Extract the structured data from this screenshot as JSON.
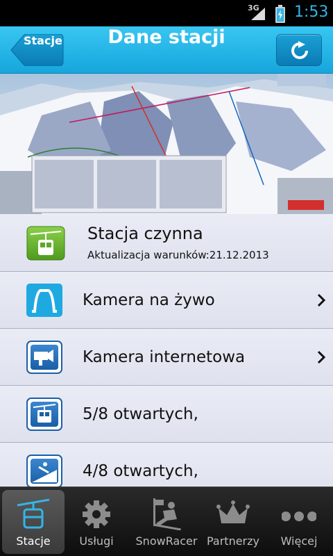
{
  "status_bar": {
    "network": "3G",
    "time": "1:53",
    "time_color": "#33b5e5"
  },
  "header": {
    "back_label": "Stacje",
    "title": "Dane stacji",
    "accent": "#1fb0e6"
  },
  "map_image": {
    "icon": "ski-resort-map-image"
  },
  "station": {
    "status": "Stacja czynna",
    "updated": "Aktualizacja warunków:21.12.2013"
  },
  "list": [
    {
      "label": "Kamera na żywo",
      "icon": "live-camera-icon"
    },
    {
      "label": "Kamera internetowa",
      "icon": "webcam-icon"
    },
    {
      "label": "5/8 otwartych,",
      "icon": "gondola-lift-icon"
    },
    {
      "label": "4/8 otwartych,",
      "icon": "ski-slope-icon"
    }
  ],
  "tabs": [
    {
      "label": "Stacje",
      "icon": "gondola-icon",
      "active": true
    },
    {
      "label": "Usługi",
      "icon": "gear-icon",
      "active": false
    },
    {
      "label": "SnowRacer",
      "icon": "skier-icon",
      "active": false
    },
    {
      "label": "Partnerzy",
      "icon": "crown-icon",
      "active": false
    },
    {
      "label": "Więcej",
      "icon": "more-dots-icon",
      "active": false
    }
  ]
}
